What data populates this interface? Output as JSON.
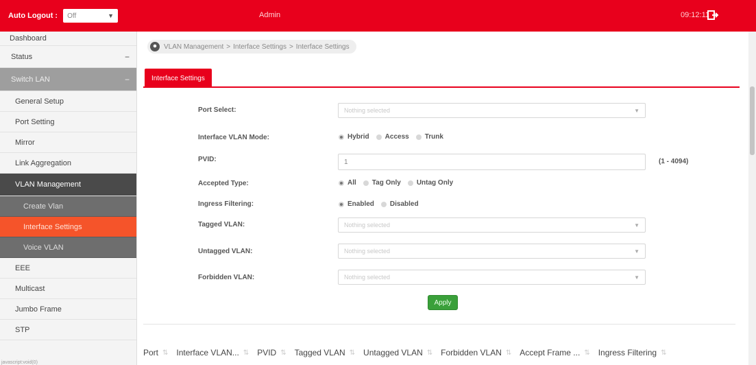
{
  "header": {
    "auto_logout_label": "Auto Logout :",
    "auto_logout_value": "Off",
    "user": "Admin",
    "clock": "09:12:11",
    "logout_icon": "logout-icon",
    "brand_color": "#e8001c"
  },
  "sidebar": {
    "items": [
      {
        "label": "Dashboard"
      },
      {
        "label": "Status",
        "toggle": "−"
      },
      {
        "label": "Switch LAN",
        "toggle": "−"
      },
      {
        "label": "General Setup"
      },
      {
        "label": "Port Setting"
      },
      {
        "label": "Mirror"
      },
      {
        "label": "Link Aggregation"
      },
      {
        "label": "VLAN Management"
      },
      {
        "label": "Create Vlan"
      },
      {
        "label": "Interface Settings"
      },
      {
        "label": "Voice VLAN"
      },
      {
        "label": "EEE"
      },
      {
        "label": "Multicast"
      },
      {
        "label": "Jumbo Frame"
      },
      {
        "label": "STP"
      }
    ],
    "footer": "javascript:void(0)",
    "active_color": "#f5542a"
  },
  "breadcrumb": {
    "icon": "location-pin-icon",
    "parts": [
      "VLAN Management",
      "Interface Settings",
      "Interface Settings"
    ],
    "sep": ">"
  },
  "tab": {
    "label": "Interface Settings"
  },
  "form": {
    "port_select": {
      "label": "Port Select:",
      "placeholder": "Nothing selected"
    },
    "vlan_mode": {
      "label": "Interface VLAN Mode:",
      "options": [
        "Hybrid",
        "Access",
        "Trunk"
      ],
      "selected": "Hybrid"
    },
    "pvid": {
      "label": "PVID:",
      "value": "1",
      "range": "(1 - 4094)"
    },
    "accepted_type": {
      "label": "Accepted Type:",
      "options": [
        "All",
        "Tag Only",
        "Untag Only"
      ],
      "selected": "All"
    },
    "ingress": {
      "label": "Ingress Filtering:",
      "options": [
        "Enabled",
        "Disabled"
      ],
      "selected": "Enabled"
    },
    "tagged": {
      "label": "Tagged VLAN:",
      "placeholder": "Nothing selected"
    },
    "untagged": {
      "label": "Untagged VLAN:",
      "placeholder": "Nothing selected"
    },
    "forbidden": {
      "label": "Forbidden VLAN:",
      "placeholder": "Nothing selected"
    },
    "apply_label": "Apply"
  },
  "table": {
    "columns": [
      "Port",
      "Interface VLAN...",
      "PVID",
      "Tagged VLAN",
      "Untagged VLAN",
      "Forbidden VLAN",
      "Accept Frame ...",
      "Ingress Filtering"
    ],
    "sort_glyph": "⇅"
  }
}
